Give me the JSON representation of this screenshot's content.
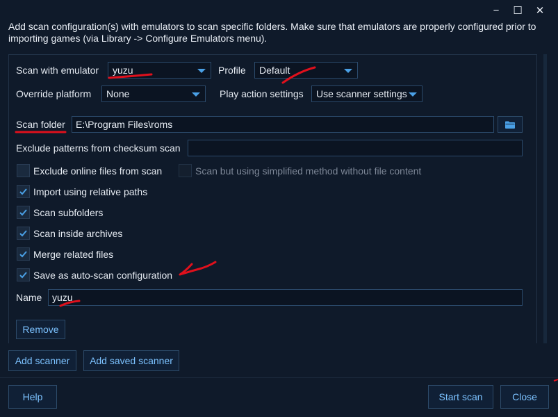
{
  "titlebar": {
    "minimize_icon": "−",
    "maximize_icon": "☐",
    "close_icon": "✕"
  },
  "intro_text": "Add scan configuration(s) with emulators to scan specific folders. Make sure that emulators are properly configured prior to importing games (via Library -> Configure Emulators menu).",
  "scanner": {
    "emulator_label": "Scan with emulator",
    "emulator_value": "yuzu",
    "profile_label": "Profile",
    "profile_value": "Default",
    "platform_label": "Override platform",
    "platform_value": "None",
    "play_action_label": "Play action settings",
    "play_action_value": "Use scanner settings",
    "scan_folder_label": "Scan folder",
    "scan_folder_value": "E:\\Program Files\\roms",
    "exclude_label": "Exclude patterns from checksum scan",
    "exclude_value": "",
    "checkboxes": [
      {
        "label": "Exclude online files from scan",
        "checked": false,
        "enabled": true
      },
      {
        "label": "Scan but using simplified method without file content",
        "checked": false,
        "enabled": false
      },
      {
        "label": "Import using relative paths",
        "checked": true,
        "enabled": true
      },
      {
        "label": "Scan subfolders",
        "checked": true,
        "enabled": true
      },
      {
        "label": "Scan inside archives",
        "checked": true,
        "enabled": true
      },
      {
        "label": "Merge related files",
        "checked": true,
        "enabled": true
      },
      {
        "label": "Save as auto-scan configuration",
        "checked": true,
        "enabled": true
      }
    ],
    "name_label": "Name",
    "name_value": "yuzu",
    "remove_label": "Remove"
  },
  "actions": {
    "add_scanner": "Add scanner",
    "add_saved_scanner": "Add saved scanner",
    "help": "Help",
    "start_scan": "Start scan",
    "close": "Close"
  },
  "colors": {
    "background": "#0f1a2a",
    "accent": "#4aa0e6",
    "button_text": "#7cc2ff",
    "annotation": "#e0101c"
  }
}
